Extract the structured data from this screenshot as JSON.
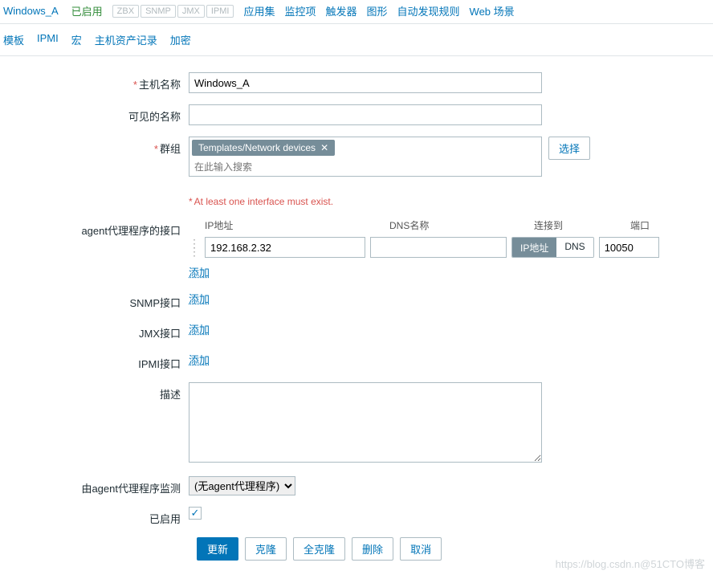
{
  "topTabs": {
    "host": "Windows_A",
    "status": "已启用",
    "badges": [
      "ZBX",
      "SNMP",
      "JMX",
      "IPMI"
    ],
    "links": [
      "应用集",
      "监控项",
      "触发器",
      "图形",
      "自动发现规则",
      "Web 场景"
    ]
  },
  "subTabs": [
    "模板",
    "IPMI",
    "宏",
    "主机资产记录",
    "加密"
  ],
  "labels": {
    "hostName": "主机名称",
    "visibleName": "可见的名称",
    "groups": "群组",
    "selectBtn": "选择",
    "hintInterface": "At least one interface must exist.",
    "agentIface": "agent代理程序的接口",
    "snmpIface": "SNMP接口",
    "jmxIface": "JMX接口",
    "ipmiIface": "IPMI接口",
    "description": "描述",
    "monitoredBy": "由agent代理程序监测",
    "enabled": "已启用",
    "addLink": "添加"
  },
  "values": {
    "hostName": "Windows_A",
    "visibleName": "",
    "groupTag": "Templates/Network devices",
    "groupPlaceholder": "在此输入搜索",
    "ip": "192.168.2.32",
    "dns": "",
    "port": "10050",
    "proxy": "(无agent代理程序)",
    "enabled": true
  },
  "ifaceCols": {
    "ip": "IP地址",
    "dns": "DNS名称",
    "connect": "连接到",
    "port": "端口"
  },
  "connectToggle": {
    "ip": "IP地址",
    "dns": "DNS"
  },
  "buttons": {
    "update": "更新",
    "clone": "克隆",
    "fullClone": "全克隆",
    "delete": "删除",
    "cancel": "取消"
  },
  "watermark": "https://blog.csdn.n@51CTO博客"
}
